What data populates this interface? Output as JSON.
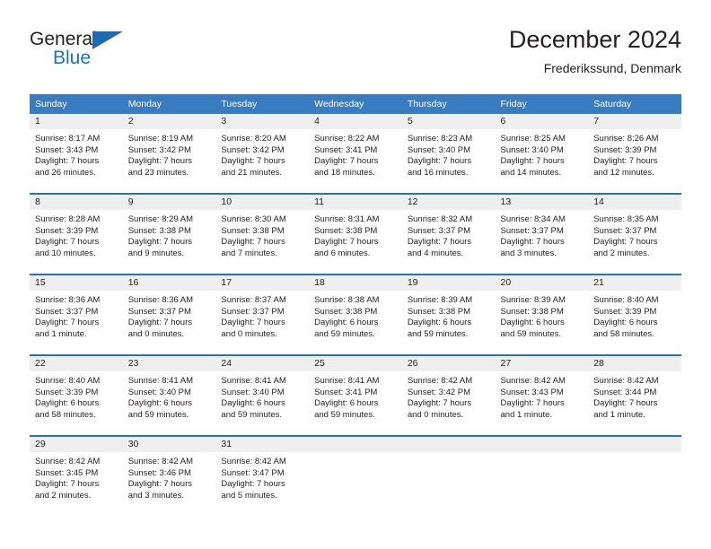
{
  "brand": {
    "name_top": "General",
    "name_bottom": "Blue",
    "triangle_color": "#1b6cb5",
    "blue_color": "#1f72bd"
  },
  "header": {
    "month_title": "December 2024",
    "location": "Frederikssund, Denmark"
  },
  "theme": {
    "header_blue": "#3a7cc0",
    "separator_blue": "#2f6fb5",
    "daynum_band": "#efefef",
    "text": "#231f20"
  },
  "weekday_headers": [
    "Sunday",
    "Monday",
    "Tuesday",
    "Wednesday",
    "Thursday",
    "Friday",
    "Saturday"
  ],
  "weeks": [
    [
      {
        "day": "1",
        "sunrise": "Sunrise: 8:17 AM",
        "sunset": "Sunset: 3:43 PM",
        "daylight_line1": "Daylight: 7 hours",
        "daylight_line2": "and 26 minutes."
      },
      {
        "day": "2",
        "sunrise": "Sunrise: 8:19 AM",
        "sunset": "Sunset: 3:42 PM",
        "daylight_line1": "Daylight: 7 hours",
        "daylight_line2": "and 23 minutes."
      },
      {
        "day": "3",
        "sunrise": "Sunrise: 8:20 AM",
        "sunset": "Sunset: 3:42 PM",
        "daylight_line1": "Daylight: 7 hours",
        "daylight_line2": "and 21 minutes."
      },
      {
        "day": "4",
        "sunrise": "Sunrise: 8:22 AM",
        "sunset": "Sunset: 3:41 PM",
        "daylight_line1": "Daylight: 7 hours",
        "daylight_line2": "and 18 minutes."
      },
      {
        "day": "5",
        "sunrise": "Sunrise: 8:23 AM",
        "sunset": "Sunset: 3:40 PM",
        "daylight_line1": "Daylight: 7 hours",
        "daylight_line2": "and 16 minutes."
      },
      {
        "day": "6",
        "sunrise": "Sunrise: 8:25 AM",
        "sunset": "Sunset: 3:40 PM",
        "daylight_line1": "Daylight: 7 hours",
        "daylight_line2": "and 14 minutes."
      },
      {
        "day": "7",
        "sunrise": "Sunrise: 8:26 AM",
        "sunset": "Sunset: 3:39 PM",
        "daylight_line1": "Daylight: 7 hours",
        "daylight_line2": "and 12 minutes."
      }
    ],
    [
      {
        "day": "8",
        "sunrise": "Sunrise: 8:28 AM",
        "sunset": "Sunset: 3:39 PM",
        "daylight_line1": "Daylight: 7 hours",
        "daylight_line2": "and 10 minutes."
      },
      {
        "day": "9",
        "sunrise": "Sunrise: 8:29 AM",
        "sunset": "Sunset: 3:38 PM",
        "daylight_line1": "Daylight: 7 hours",
        "daylight_line2": "and 9 minutes."
      },
      {
        "day": "10",
        "sunrise": "Sunrise: 8:30 AM",
        "sunset": "Sunset: 3:38 PM",
        "daylight_line1": "Daylight: 7 hours",
        "daylight_line2": "and 7 minutes."
      },
      {
        "day": "11",
        "sunrise": "Sunrise: 8:31 AM",
        "sunset": "Sunset: 3:38 PM",
        "daylight_line1": "Daylight: 7 hours",
        "daylight_line2": "and 6 minutes."
      },
      {
        "day": "12",
        "sunrise": "Sunrise: 8:32 AM",
        "sunset": "Sunset: 3:37 PM",
        "daylight_line1": "Daylight: 7 hours",
        "daylight_line2": "and 4 minutes."
      },
      {
        "day": "13",
        "sunrise": "Sunrise: 8:34 AM",
        "sunset": "Sunset: 3:37 PM",
        "daylight_line1": "Daylight: 7 hours",
        "daylight_line2": "and 3 minutes."
      },
      {
        "day": "14",
        "sunrise": "Sunrise: 8:35 AM",
        "sunset": "Sunset: 3:37 PM",
        "daylight_line1": "Daylight: 7 hours",
        "daylight_line2": "and 2 minutes."
      }
    ],
    [
      {
        "day": "15",
        "sunrise": "Sunrise: 8:36 AM",
        "sunset": "Sunset: 3:37 PM",
        "daylight_line1": "Daylight: 7 hours",
        "daylight_line2": "and 1 minute."
      },
      {
        "day": "16",
        "sunrise": "Sunrise: 8:36 AM",
        "sunset": "Sunset: 3:37 PM",
        "daylight_line1": "Daylight: 7 hours",
        "daylight_line2": "and 0 minutes."
      },
      {
        "day": "17",
        "sunrise": "Sunrise: 8:37 AM",
        "sunset": "Sunset: 3:37 PM",
        "daylight_line1": "Daylight: 7 hours",
        "daylight_line2": "and 0 minutes."
      },
      {
        "day": "18",
        "sunrise": "Sunrise: 8:38 AM",
        "sunset": "Sunset: 3:38 PM",
        "daylight_line1": "Daylight: 6 hours",
        "daylight_line2": "and 59 minutes."
      },
      {
        "day": "19",
        "sunrise": "Sunrise: 8:39 AM",
        "sunset": "Sunset: 3:38 PM",
        "daylight_line1": "Daylight: 6 hours",
        "daylight_line2": "and 59 minutes."
      },
      {
        "day": "20",
        "sunrise": "Sunrise: 8:39 AM",
        "sunset": "Sunset: 3:38 PM",
        "daylight_line1": "Daylight: 6 hours",
        "daylight_line2": "and 59 minutes."
      },
      {
        "day": "21",
        "sunrise": "Sunrise: 8:40 AM",
        "sunset": "Sunset: 3:39 PM",
        "daylight_line1": "Daylight: 6 hours",
        "daylight_line2": "and 58 minutes."
      }
    ],
    [
      {
        "day": "22",
        "sunrise": "Sunrise: 8:40 AM",
        "sunset": "Sunset: 3:39 PM",
        "daylight_line1": "Daylight: 6 hours",
        "daylight_line2": "and 58 minutes."
      },
      {
        "day": "23",
        "sunrise": "Sunrise: 8:41 AM",
        "sunset": "Sunset: 3:40 PM",
        "daylight_line1": "Daylight: 6 hours",
        "daylight_line2": "and 59 minutes."
      },
      {
        "day": "24",
        "sunrise": "Sunrise: 8:41 AM",
        "sunset": "Sunset: 3:40 PM",
        "daylight_line1": "Daylight: 6 hours",
        "daylight_line2": "and 59 minutes."
      },
      {
        "day": "25",
        "sunrise": "Sunrise: 8:41 AM",
        "sunset": "Sunset: 3:41 PM",
        "daylight_line1": "Daylight: 6 hours",
        "daylight_line2": "and 59 minutes."
      },
      {
        "day": "26",
        "sunrise": "Sunrise: 8:42 AM",
        "sunset": "Sunset: 3:42 PM",
        "daylight_line1": "Daylight: 7 hours",
        "daylight_line2": "and 0 minutes."
      },
      {
        "day": "27",
        "sunrise": "Sunrise: 8:42 AM",
        "sunset": "Sunset: 3:43 PM",
        "daylight_line1": "Daylight: 7 hours",
        "daylight_line2": "and 1 minute."
      },
      {
        "day": "28",
        "sunrise": "Sunrise: 8:42 AM",
        "sunset": "Sunset: 3:44 PM",
        "daylight_line1": "Daylight: 7 hours",
        "daylight_line2": "and 1 minute."
      }
    ],
    [
      {
        "day": "29",
        "sunrise": "Sunrise: 8:42 AM",
        "sunset": "Sunset: 3:45 PM",
        "daylight_line1": "Daylight: 7 hours",
        "daylight_line2": "and 2 minutes."
      },
      {
        "day": "30",
        "sunrise": "Sunrise: 8:42 AM",
        "sunset": "Sunset: 3:46 PM",
        "daylight_line1": "Daylight: 7 hours",
        "daylight_line2": "and 3 minutes."
      },
      {
        "day": "31",
        "sunrise": "Sunrise: 8:42 AM",
        "sunset": "Sunset: 3:47 PM",
        "daylight_line1": "Daylight: 7 hours",
        "daylight_line2": "and 5 minutes."
      },
      {
        "day": "",
        "sunrise": "",
        "sunset": "",
        "daylight_line1": "",
        "daylight_line2": ""
      },
      {
        "day": "",
        "sunrise": "",
        "sunset": "",
        "daylight_line1": "",
        "daylight_line2": ""
      },
      {
        "day": "",
        "sunrise": "",
        "sunset": "",
        "daylight_line1": "",
        "daylight_line2": ""
      },
      {
        "day": "",
        "sunrise": "",
        "sunset": "",
        "daylight_line1": "",
        "daylight_line2": ""
      }
    ]
  ]
}
